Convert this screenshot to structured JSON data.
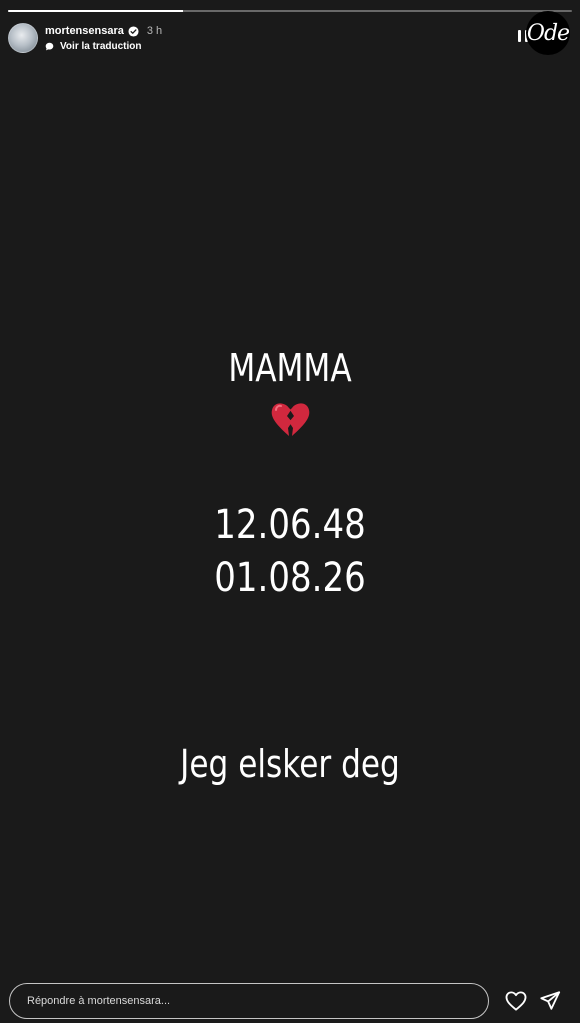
{
  "story": {
    "progress": 0.31,
    "username": "mortensensara",
    "time_ago": "3 h",
    "translate_label": "Voir la traduction",
    "brand_logo_text": "Ode",
    "background_color": "#1a1a1a"
  },
  "content": {
    "title": "MAMMA",
    "emoji": "broken-heart-icon",
    "date_birth": "12.06.48",
    "date_death": "01.08.26",
    "message": "Jeg elsker deg"
  },
  "reply": {
    "placeholder": "Répondre à mortensensara..."
  },
  "icons": {
    "like": "heart-outline-icon",
    "share": "paper-plane-icon",
    "pause": "pause-icon",
    "verified": "verified-badge-icon",
    "translate": "speech-bubble-icon"
  }
}
